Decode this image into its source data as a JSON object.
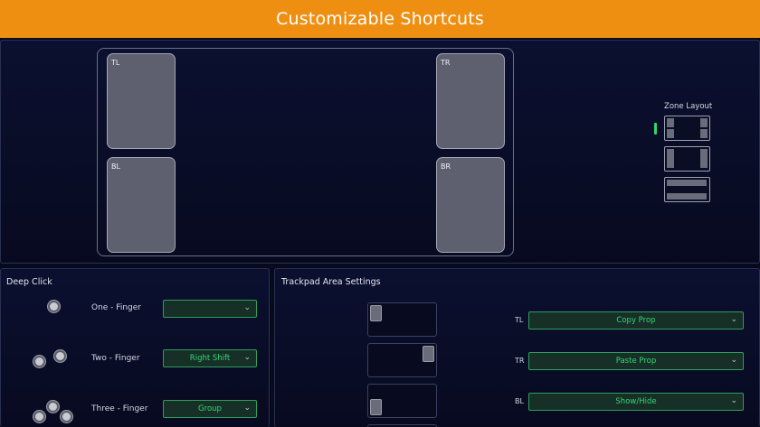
{
  "header": {
    "title": "Customizable Shortcuts"
  },
  "trackpad": {
    "zones": [
      {
        "id": "tl",
        "label": "TL"
      },
      {
        "id": "tr",
        "label": "TR"
      },
      {
        "id": "bl",
        "label": "BL"
      },
      {
        "id": "br",
        "label": "BR"
      }
    ]
  },
  "zone_layout": {
    "title": "Zone Layout",
    "selected_index": 0,
    "accent_color": "#2fd672"
  },
  "deep_click": {
    "title": "Deep Click",
    "rows": [
      {
        "label": "One - Finger",
        "value": ""
      },
      {
        "label": "Two - Finger",
        "value": "Right Shift"
      },
      {
        "label": "Three - Finger",
        "value": "Group"
      }
    ]
  },
  "area_settings": {
    "title": "Trackpad Area Settings",
    "rows": [
      {
        "zone": "TL",
        "value": "Copy Prop"
      },
      {
        "zone": "TR",
        "value": "Paste Prop"
      },
      {
        "zone": "BL",
        "value": "Show/Hide"
      }
    ]
  },
  "colors": {
    "banner": "#ef8f12",
    "dropdown_text": "#34d874",
    "dropdown_border": "#2f9d5c",
    "background": "#070a1c"
  }
}
